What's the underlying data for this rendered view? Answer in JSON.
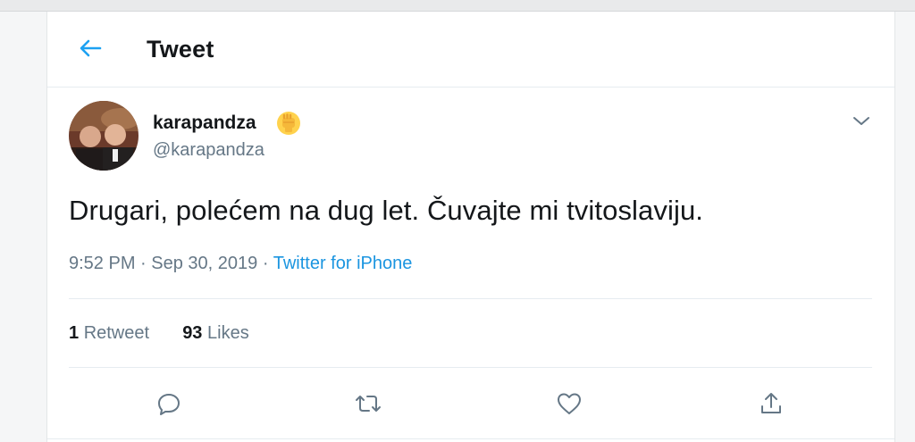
{
  "header": {
    "title": "Tweet",
    "back_icon": "arrow-left-icon",
    "accent_color": "#1da1f2"
  },
  "tweet": {
    "display_name": "karapandza",
    "handle": "@karapandza",
    "badge_icon": "raised-fist-emoji-icon",
    "menu_icon": "chevron-down-icon",
    "text": "Drugari, polećem na dug let. Čuvajte mi tvitoslaviju.",
    "time": "9:52 PM",
    "separator": "·",
    "date": "Sep 30, 2019",
    "source": "Twitter for iPhone",
    "source_color": "#1b95e0"
  },
  "stats": {
    "retweets_count": "1",
    "retweets_label": "Retweet",
    "likes_count": "93",
    "likes_label": "Likes"
  },
  "actions": [
    {
      "icon": "reply-icon"
    },
    {
      "icon": "retweet-icon"
    },
    {
      "icon": "like-icon"
    },
    {
      "icon": "share-icon"
    }
  ]
}
